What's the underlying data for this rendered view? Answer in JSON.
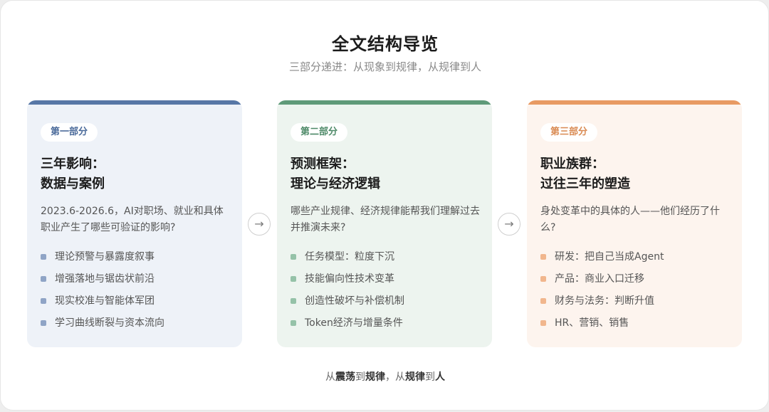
{
  "header": {
    "title": "全文结构导览",
    "subtitle": "三部分递进：从现象到规律，从规律到人"
  },
  "cards": [
    {
      "badge": "第一部分",
      "title_line1": "三年影响：",
      "title_line2": "数据与案例",
      "description": "2023.6-2026.6，AI对职场、就业和具体职业产生了哪些可验证的影响?",
      "items": [
        "理论预警与暴露度叙事",
        "增强落地与锯齿状前沿",
        "现实校准与智能体军团",
        "学习曲线断裂与资本流向"
      ],
      "accent": "#5777a6"
    },
    {
      "badge": "第二部分",
      "title_line1": "预测框架：",
      "title_line2": "理论与经济逻辑",
      "description": "哪些产业规律、经济规律能帮我们理解过去并推演未来?",
      "items": [
        "任务模型：粒度下沉",
        "技能偏向性技术变革",
        "创造性破坏与补偿机制",
        "Token经济与增量条件"
      ],
      "accent": "#5f9a79"
    },
    {
      "badge": "第三部分",
      "title_line1": "职业族群：",
      "title_line2": "过往三年的塑造",
      "description": "身处变革中的具体的人——他们经历了什么?",
      "items": [
        "研发：把自己当成Agent",
        "产品：商业入口迁移",
        "财务与法务：判断升值",
        "HR、营销、销售"
      ],
      "accent": "#e89a63"
    }
  ],
  "arrows": [
    "→",
    "→"
  ],
  "footer": {
    "p1": "从",
    "b1": "震荡",
    "p2": "到",
    "b2": "规律",
    "p3": "，从",
    "b3": "规律",
    "p4": "到",
    "b4": "人"
  }
}
